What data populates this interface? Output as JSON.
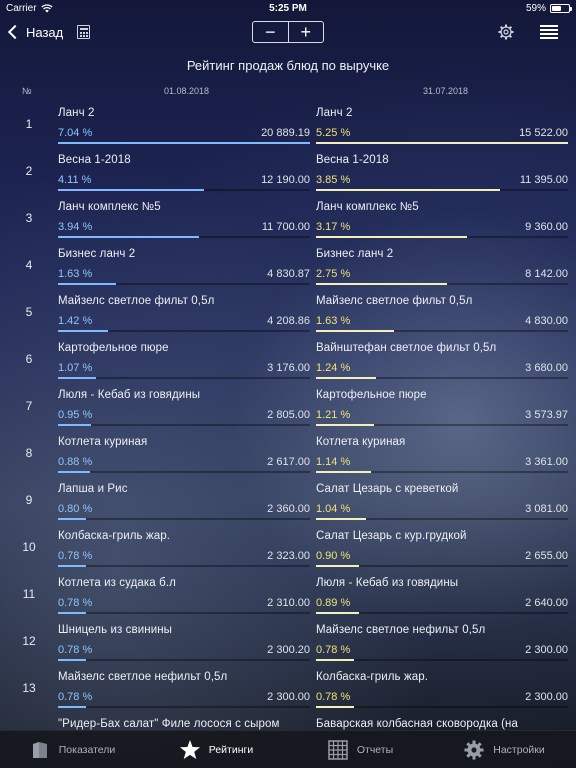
{
  "status": {
    "carrier": "Carrier",
    "time": "5:25 PM",
    "battery": "59%",
    "battery_level": 0.59
  },
  "nav": {
    "back_label": "Назад",
    "minus": "−",
    "plus": "+"
  },
  "title": "Рейтинг продаж блюд по выручке",
  "columns": {
    "num": "№",
    "left_date": "01.08.2018",
    "right_date": "31.07.2018"
  },
  "rows": [
    {
      "n": "1",
      "left": {
        "name": "Ланч 2",
        "pct": "7.04 %",
        "value": "20 889.19",
        "bar": 1.0
      },
      "right": {
        "name": "Ланч 2",
        "pct": "5.25 %",
        "value": "15 522.00",
        "bar": 1.0
      }
    },
    {
      "n": "2",
      "left": {
        "name": "Весна 1-2018",
        "pct": "4.11 %",
        "value": "12 190.00",
        "bar": 0.58
      },
      "right": {
        "name": "Весна 1-2018",
        "pct": "3.85 %",
        "value": "11 395.00",
        "bar": 0.73
      }
    },
    {
      "n": "3",
      "left": {
        "name": "Ланч комплекс №5",
        "pct": "3.94 %",
        "value": "11 700.00",
        "bar": 0.56
      },
      "right": {
        "name": "Ланч комплекс №5",
        "pct": "3.17 %",
        "value": "9 360.00",
        "bar": 0.6
      }
    },
    {
      "n": "4",
      "left": {
        "name": "Бизнес ланч 2",
        "pct": "1.63 %",
        "value": "4 830.87",
        "bar": 0.23
      },
      "right": {
        "name": "Бизнес ланч 2",
        "pct": "2.75 %",
        "value": "8 142.00",
        "bar": 0.52
      }
    },
    {
      "n": "5",
      "left": {
        "name": "Майзелс светлое фильт 0,5л",
        "pct": "1.42 %",
        "value": "4 208.86",
        "bar": 0.2
      },
      "right": {
        "name": "Майзелс светлое фильт 0,5л",
        "pct": "1.63 %",
        "value": "4 830.00",
        "bar": 0.31
      }
    },
    {
      "n": "6",
      "left": {
        "name": "Картофельное пюре",
        "pct": "1.07 %",
        "value": "3 176.00",
        "bar": 0.15
      },
      "right": {
        "name": "Вайнштефан светлое фильт 0,5л",
        "pct": "1.24 %",
        "value": "3 680.00",
        "bar": 0.24
      }
    },
    {
      "n": "7",
      "left": {
        "name": "Люля - Кебаб из говядины",
        "pct": "0.95 %",
        "value": "2 805.00",
        "bar": 0.13
      },
      "right": {
        "name": "Картофельное пюре",
        "pct": "1.21 %",
        "value": "3 573.97",
        "bar": 0.23
      }
    },
    {
      "n": "8",
      "left": {
        "name": "Котлета куриная",
        "pct": "0.88 %",
        "value": "2 617.00",
        "bar": 0.125
      },
      "right": {
        "name": "Котлета куриная",
        "pct": "1.14 %",
        "value": "3 361.00",
        "bar": 0.22
      }
    },
    {
      "n": "9",
      "left": {
        "name": "Лапша и Рис",
        "pct": "0.80 %",
        "value": "2 360.00",
        "bar": 0.113
      },
      "right": {
        "name": "Салат Цезарь с креветкой",
        "pct": "1.04 %",
        "value": "3 081.00",
        "bar": 0.2
      }
    },
    {
      "n": "10",
      "left": {
        "name": "Колбаска-гриль жар.",
        "pct": "0.78 %",
        "value": "2 323.00",
        "bar": 0.111
      },
      "right": {
        "name": "Салат Цезарь с кур.грудкой",
        "pct": "0.90 %",
        "value": "2 655.00",
        "bar": 0.17
      }
    },
    {
      "n": "11",
      "left": {
        "name": "Котлета из судака б.л",
        "pct": "0.78 %",
        "value": "2 310.00",
        "bar": 0.11
      },
      "right": {
        "name": "Люля - Кебаб из говядины",
        "pct": "0.89 %",
        "value": "2 640.00",
        "bar": 0.17
      }
    },
    {
      "n": "12",
      "left": {
        "name": "Шницель из свинины",
        "pct": "0.78 %",
        "value": "2 300.20",
        "bar": 0.11
      },
      "right": {
        "name": "Майзелс светлое нефильт 0,5л",
        "pct": "0.78 %",
        "value": "2 300.00",
        "bar": 0.15
      }
    },
    {
      "n": "13",
      "left": {
        "name": "Майзелс светлое нефильт 0,5л",
        "pct": "0.78 %",
        "value": "2 300.00",
        "bar": 0.11
      },
      "right": {
        "name": "Колбаска-гриль жар.",
        "pct": "0.78 %",
        "value": "2 300.00",
        "bar": 0.15
      }
    },
    {
      "n": "",
      "left": {
        "name": "\"Ридер-Бах салат\" Филе лосося с сыром",
        "pct": "",
        "value": "",
        "bar": 0
      },
      "right": {
        "name": "Баварская  колбасная сковородка (на",
        "pct": "",
        "value": "",
        "bar": 0
      }
    }
  ],
  "tabs": [
    {
      "label": "Показатели",
      "icon": "chart-book-icon",
      "active": false
    },
    {
      "label": "Рейтинги",
      "icon": "star-icon",
      "active": true
    },
    {
      "label": "Отчеты",
      "icon": "grid-table-icon",
      "active": false
    },
    {
      "label": "Настройки",
      "icon": "gear-icon",
      "active": false
    }
  ],
  "colors": {
    "left_accent": "#8ec5ff",
    "right_accent": "#f0e27a"
  }
}
